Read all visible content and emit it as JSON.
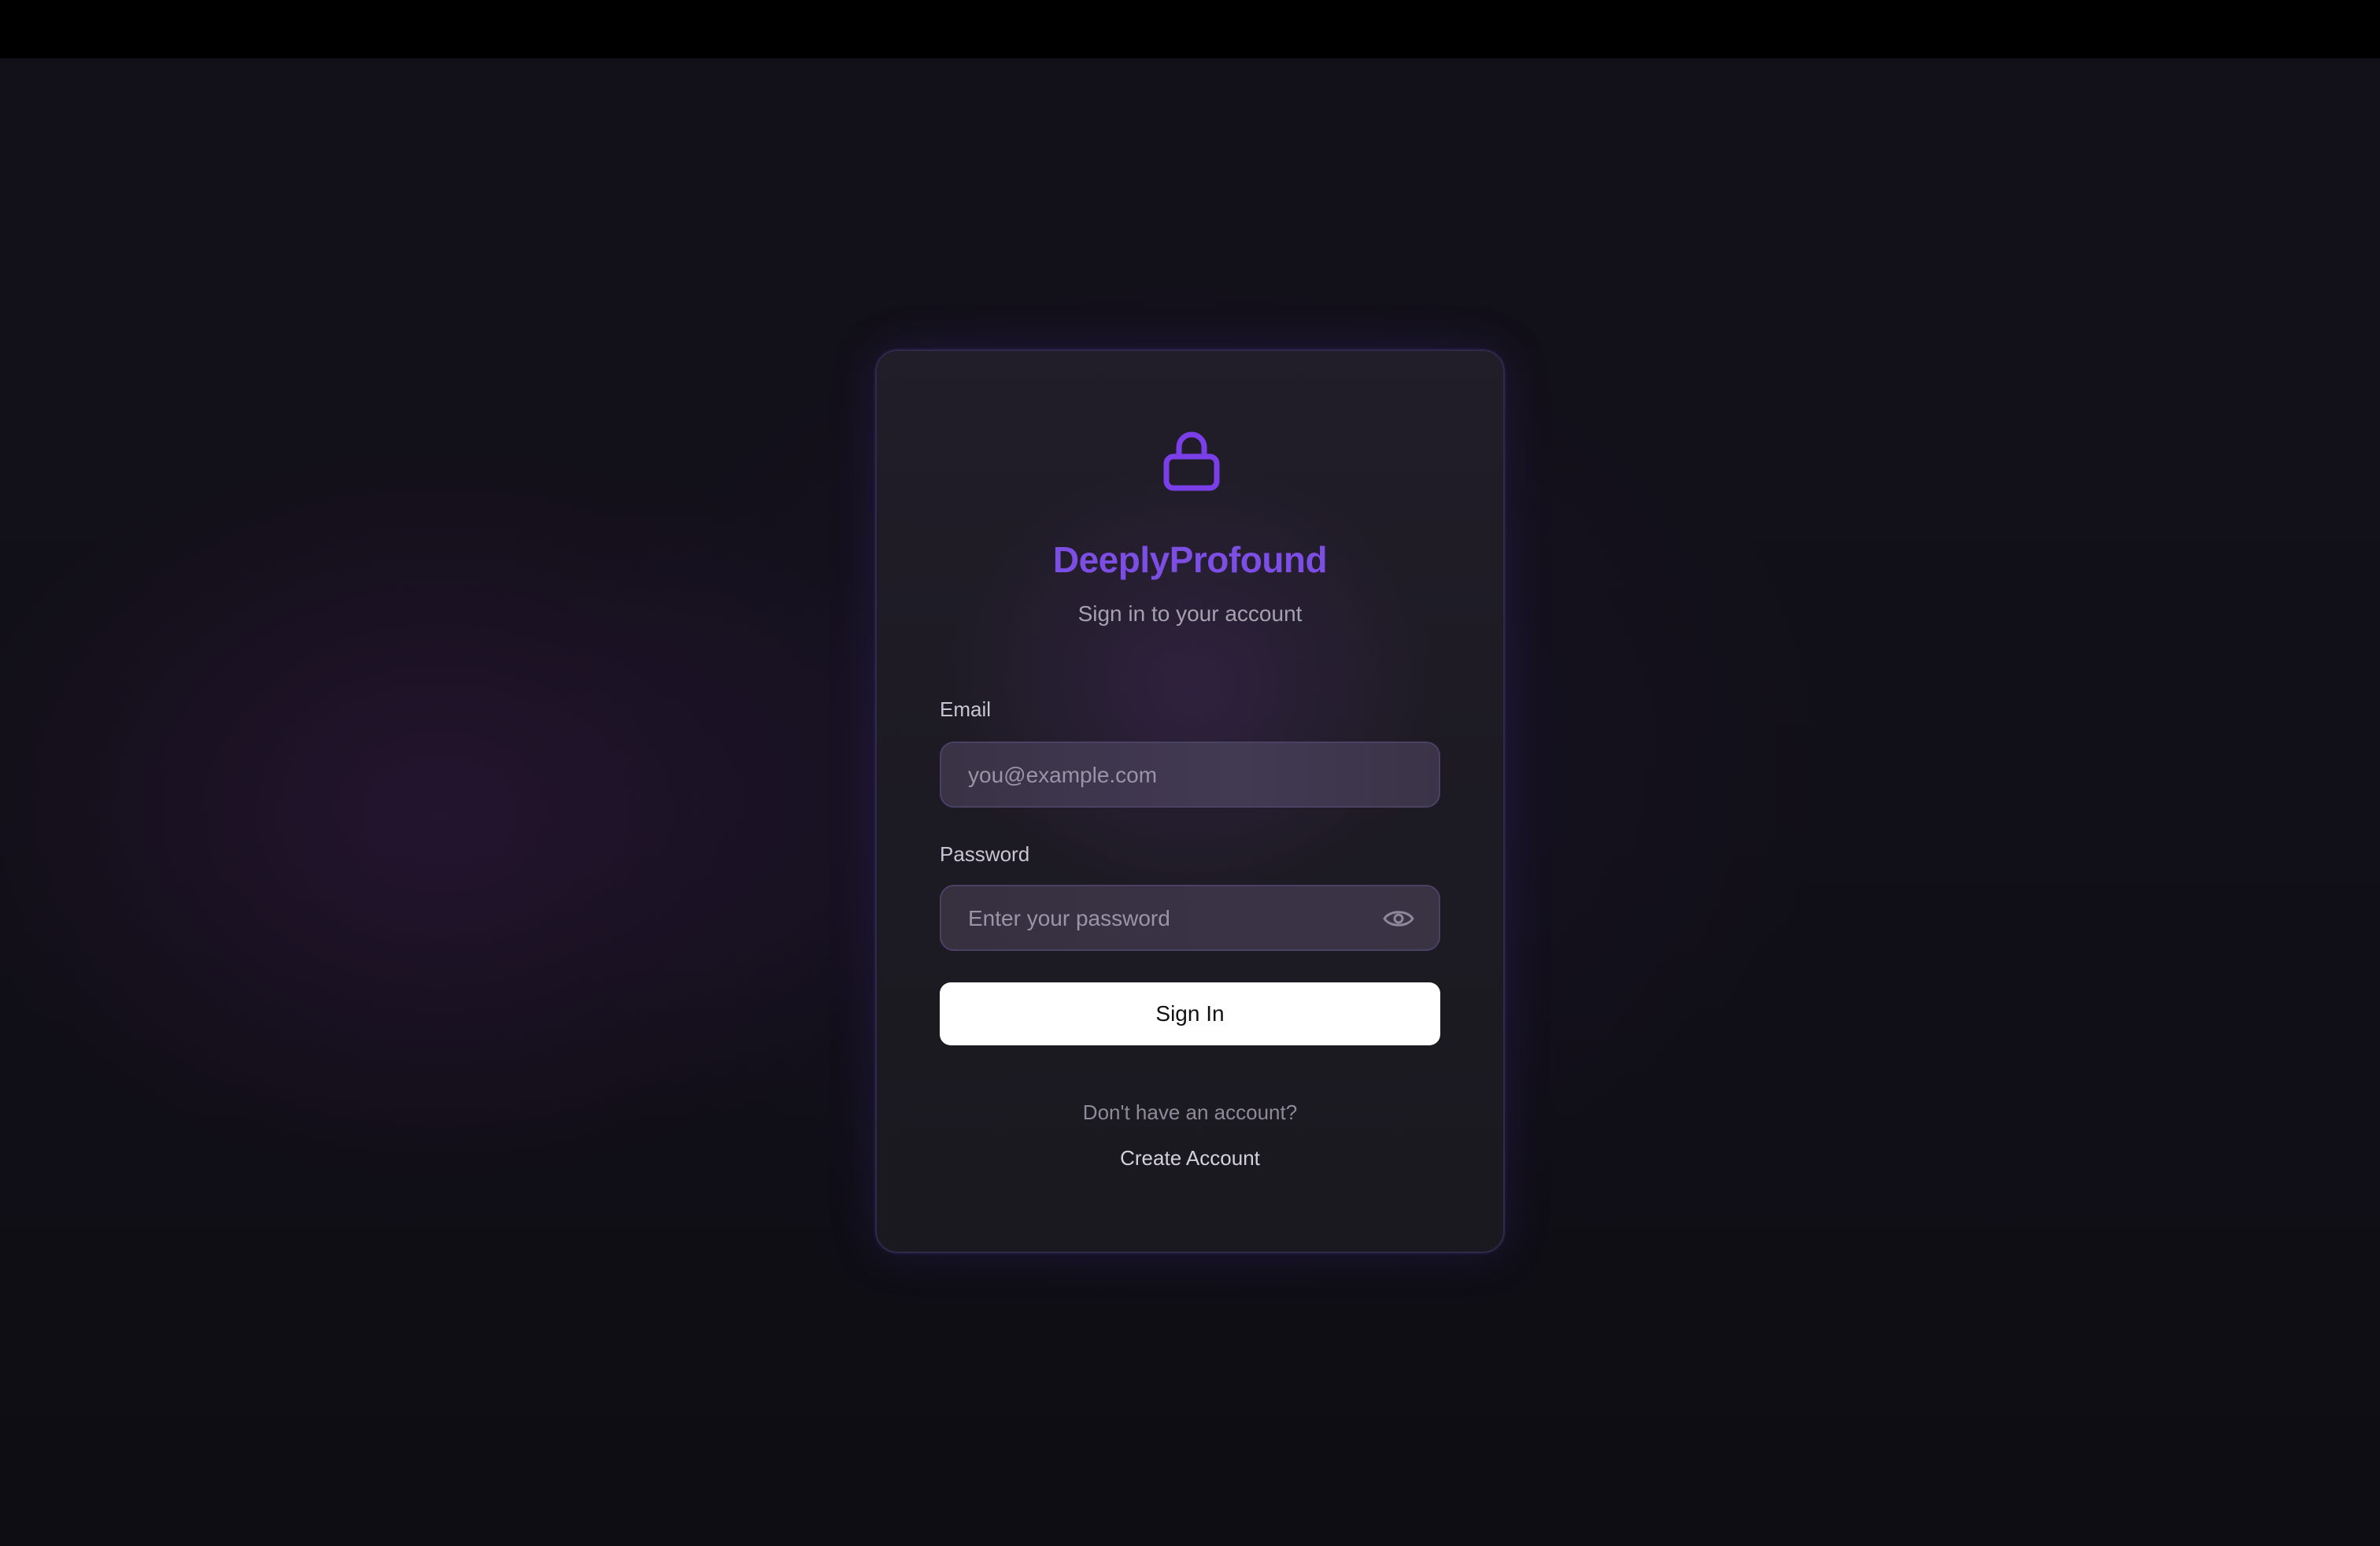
{
  "app": {
    "brand": "DeeplyProfound",
    "subtitle": "Sign in to your account",
    "accent_color": "#7c4ee4"
  },
  "form": {
    "email": {
      "label": "Email",
      "placeholder": "you@example.com",
      "value": ""
    },
    "password": {
      "label": "Password",
      "placeholder": "Enter your password",
      "value": "",
      "toggle_icon": "eye-icon"
    },
    "submit_label": "Sign In"
  },
  "footer": {
    "prompt": "Don't have an account?",
    "create_label": "Create Account"
  },
  "icons": {
    "header_icon": "lock-icon"
  }
}
